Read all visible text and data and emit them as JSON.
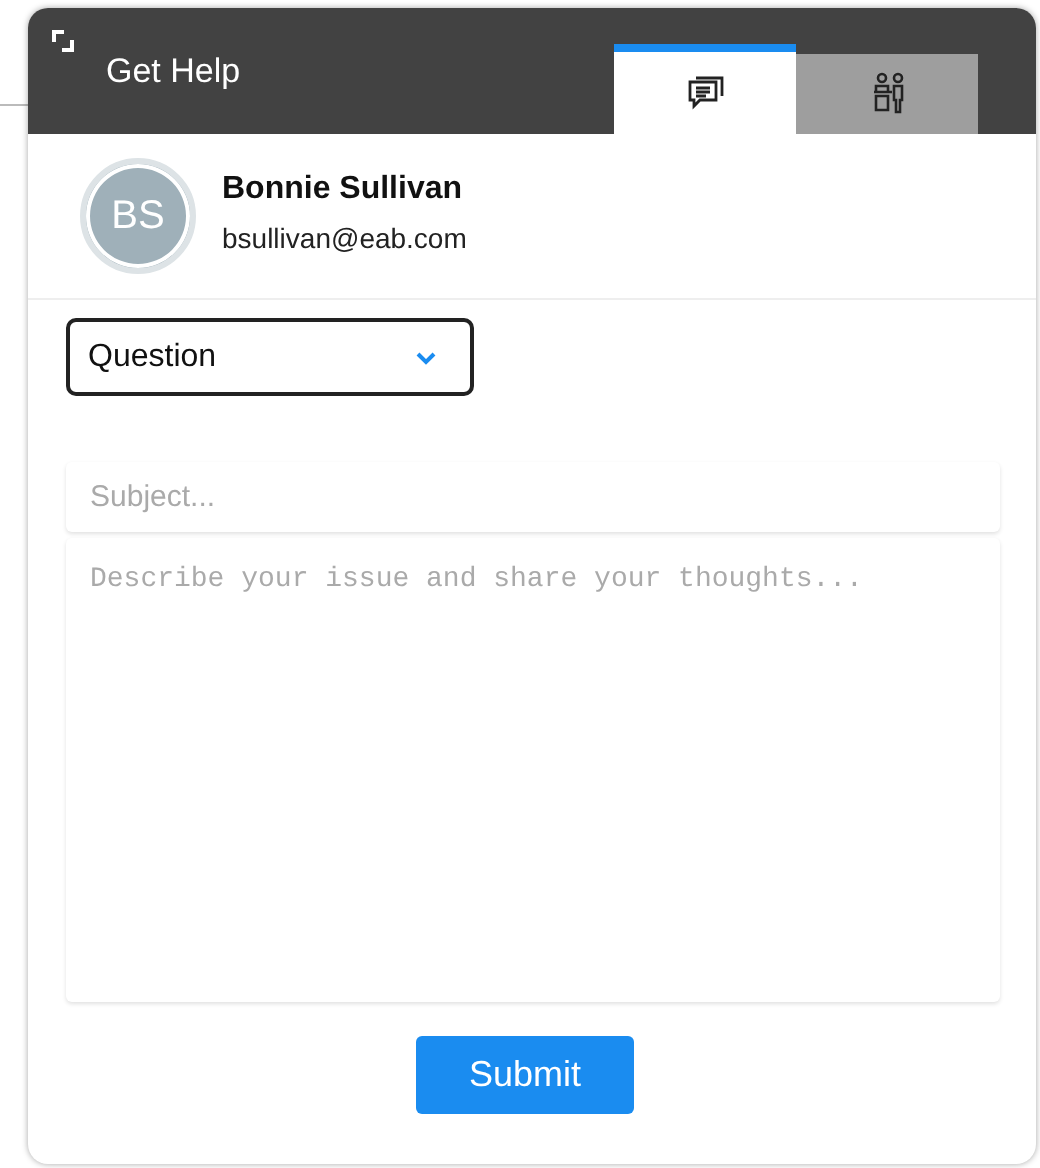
{
  "header": {
    "title": "Get Help"
  },
  "tabs": [
    {
      "kind": "chat",
      "selected": true
    },
    {
      "kind": "people",
      "selected": false
    }
  ],
  "profile": {
    "initials": "BS",
    "name": "Bonnie Sullivan",
    "email": "bsullivan@eab.com"
  },
  "category": {
    "value": "Question"
  },
  "subject": {
    "placeholder": "Subject..."
  },
  "description": {
    "placeholder": "Describe your issue and share your thoughts..."
  },
  "submit": {
    "label": "Submit"
  }
}
